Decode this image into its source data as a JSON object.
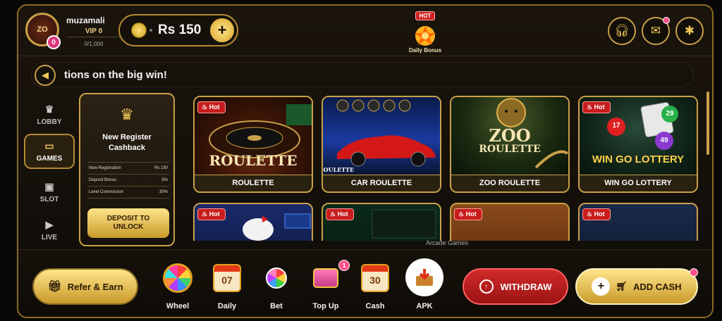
{
  "header": {
    "username": "muzamali",
    "avatar_text": "ZO",
    "avatar_badge": "0",
    "vip": "VIP 0",
    "vip_progress": "0/1,000",
    "balance": "Rs 150",
    "add_button": "+",
    "bonus_tag": "HOT",
    "bonus_label": "Daily Bonus"
  },
  "marquee": {
    "text": "tions on the big win!"
  },
  "sidebar": {
    "items": [
      {
        "label": "LOBBY",
        "icon": "crown-icon"
      },
      {
        "label": "GAMES",
        "icon": "gamepad-icon",
        "active": true
      },
      {
        "label": "SLOT",
        "icon": "slot-icon"
      },
      {
        "label": "LIVE",
        "icon": "play-icon"
      }
    ]
  },
  "cashback": {
    "title_line1": "New Register",
    "title_line2": "Cashback",
    "rows": [
      {
        "label": "New Registration",
        "value": "Rs 150"
      },
      {
        "label": "Deposit Bonus",
        "value": "5%"
      },
      {
        "label": "Level Commission",
        "value": "30%"
      }
    ],
    "button_line1": "DEPOSIT TO",
    "button_line2": "UNLOCK"
  },
  "games": {
    "hot_label": "Hot",
    "cards": [
      {
        "label": "ROULETTE",
        "art_text": "ROULETTE",
        "hot": true
      },
      {
        "label": "CAR ROULETTE",
        "art_text": "ROULETTE",
        "hot": false
      },
      {
        "label": "ZOO ROULETTE",
        "art_text_1": "ZOO",
        "art_text_2": "ROULETTE",
        "hot": false
      },
      {
        "label": "WIN GO LOTTERY",
        "art_text": "WIN GO LOTTERY",
        "ball_1": "17",
        "ball_2": "29",
        "ball_3": "49",
        "hot": true
      }
    ],
    "row2_hot": [
      "Hot",
      "Hot",
      "Hot",
      "Hot"
    ],
    "section_caption": "Arcade Games"
  },
  "bottom": {
    "refer": "Refer & Earn",
    "quick": [
      {
        "label": "Wheel",
        "icon": "wheel-icon"
      },
      {
        "label": "Daily",
        "icon": "calendar-icon",
        "value": "07"
      },
      {
        "label": "Bet",
        "icon": "bet-icon"
      },
      {
        "label": "Top Up",
        "icon": "chest-icon",
        "badge": "1"
      },
      {
        "label": "Cash",
        "icon": "calendar-icon",
        "value": "30"
      },
      {
        "label": "APK",
        "icon": "download-icon"
      }
    ],
    "withdraw": "WITHDRAW",
    "add_cash": "ADD CASH"
  },
  "colors": {
    "gold": "#c9a04a",
    "accent_red": "#d02a2a",
    "pink_badge": "#ff4f8a"
  }
}
